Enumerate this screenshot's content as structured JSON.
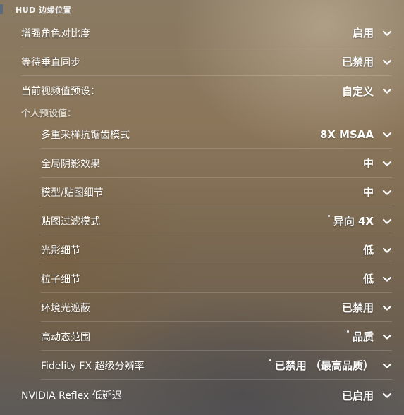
{
  "section": {
    "label": "HUD 边缘位置"
  },
  "settings": [
    {
      "label": "增强角色对比度",
      "value": "启用",
      "dot": false
    },
    {
      "label": "等待垂直同步",
      "value": "已禁用",
      "dot": false
    },
    {
      "label": "当前视频值预设：",
      "value": "自定义",
      "dot": false
    }
  ],
  "group_header": "个人预设值：",
  "sub_settings": [
    {
      "label": "多重采样抗锯齿模式",
      "value": "8X MSAA",
      "dot": false
    },
    {
      "label": "全局阴影效果",
      "value": "中",
      "dot": false
    },
    {
      "label": "模型/贴图细节",
      "value": "中",
      "dot": false
    },
    {
      "label": "贴图过滤模式",
      "value": "异向 4X",
      "dot": true
    },
    {
      "label": "光影细节",
      "value": "低",
      "dot": false
    },
    {
      "label": "粒子细节",
      "value": "低",
      "dot": false
    },
    {
      "label": "环境光遮蔽",
      "value": "已禁用",
      "dot": false
    },
    {
      "label": "高动态范围",
      "value": "品质",
      "dot": true
    },
    {
      "label": "Fidelity FX 超级分辨率",
      "value": "已禁用 （最高品质）",
      "dot": true
    }
  ],
  "bottom_setting": {
    "label": "NVIDIA Reflex 低延迟",
    "value": "已启用",
    "dot": false
  },
  "icons": {
    "dropdown": "chevron-down-icon"
  }
}
